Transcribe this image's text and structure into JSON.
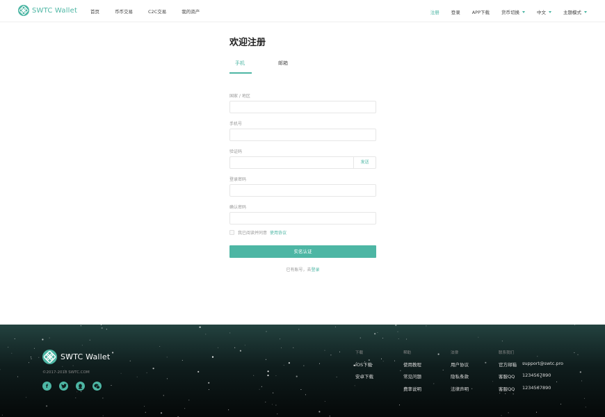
{
  "header": {
    "brand": "SWTC Wallet",
    "nav_left": [
      "首页",
      "币币交易",
      "C2C交易",
      "我的资产"
    ],
    "nav_right": {
      "register": "注册",
      "login": "登录",
      "app_download": "APP下载",
      "currency_switch": "货币切换",
      "language": "中文",
      "theme_mode": "主题模式"
    }
  },
  "form": {
    "title": "欢迎注册",
    "tabs": {
      "phone": "手机",
      "email": "邮箱"
    },
    "country_label": "国家 / 地区",
    "country_value": "",
    "phone_label": "手机号",
    "phone_value": "",
    "code_label": "验证码",
    "code_value": "",
    "send_label": "发送",
    "password_label": "登录密码",
    "password_value": "",
    "confirm_label": "确认密码",
    "confirm_value": "",
    "agree_text": "我已阅读并同意",
    "agree_link": "使用协议",
    "submit_label": "实名认证",
    "have_account": "已有账号，去",
    "login_link": "登录"
  },
  "footer": {
    "brand": "SWTC Wallet",
    "copyright": "©2017-2018 SWTC.COM",
    "social_icons": [
      "facebook-icon",
      "twitter-icon",
      "qq-icon",
      "wechat-icon"
    ],
    "download": {
      "title": "下载",
      "items": [
        "IOS下载",
        "安卓下载"
      ]
    },
    "help": {
      "title": "帮助",
      "items": [
        "使用教程",
        "常见问题",
        "费率说明"
      ]
    },
    "legal": {
      "title": "法律",
      "items": [
        "用户协议",
        "隐私条款",
        "法律声明"
      ]
    },
    "contact": {
      "title": "联系我们",
      "rows": [
        {
          "key": "官方邮箱",
          "value": "support@swtc.pro"
        },
        {
          "key": "客服QQ",
          "value": "1234567890"
        },
        {
          "key": "客服QQ",
          "value": "1234567890"
        }
      ]
    }
  },
  "colors": {
    "accent": "#4db6a4",
    "footer_bg": "#0f1d1d"
  }
}
